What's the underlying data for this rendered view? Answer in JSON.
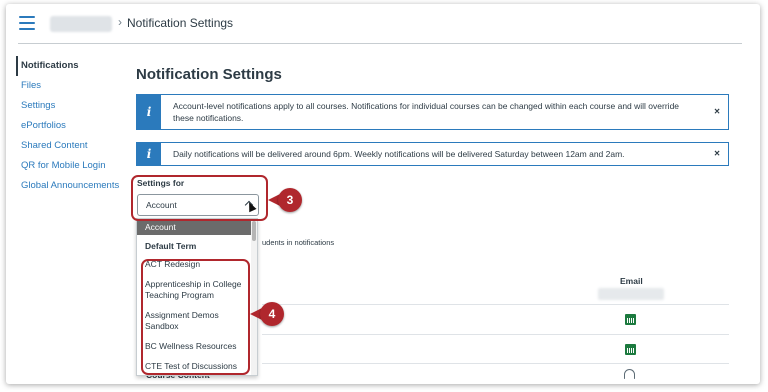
{
  "header": {
    "breadcrumb_current": "Notification Settings",
    "separator": "›"
  },
  "sidebar": {
    "items": [
      {
        "label": "Notifications"
      },
      {
        "label": "Files"
      },
      {
        "label": "Settings"
      },
      {
        "label": "ePortfolios"
      },
      {
        "label": "Shared Content"
      },
      {
        "label": "QR for Mobile Login"
      },
      {
        "label": "Global Announcements"
      }
    ]
  },
  "main": {
    "title": "Notification Settings",
    "alerts": [
      {
        "icon": "info-icon",
        "glyph": "i",
        "text": "Account-level notifications apply to all courses. Notifications for individual courses can be changed within each course and will override these notifications.",
        "close": "×"
      },
      {
        "icon": "info-icon",
        "glyph": "i",
        "text": "Daily notifications will be delivered around 6pm. Weekly notifications will be delivered Saturday between 12am and 2am.",
        "close": "×"
      }
    ],
    "settings_for_label": "Settings for",
    "select_value": "Account",
    "dropdown": {
      "selected_option": "Account",
      "group_header": "Default Term",
      "options": [
        "ACT Redesign",
        "Apprenticeship in College Teaching Program",
        "Assignment Demos Sandbox",
        "BC Wellness Resources",
        "CTE Test of Discussions"
      ]
    },
    "partial_text": "udents in notifications",
    "email_header": "Email",
    "course_content_label": "Course Content"
  },
  "callouts": {
    "first": "3",
    "second": "4"
  },
  "colors": {
    "link": "#2b7abc",
    "callout": "#b0272d",
    "text": "#2d3b45",
    "icon_green": "#1c7a3f"
  }
}
